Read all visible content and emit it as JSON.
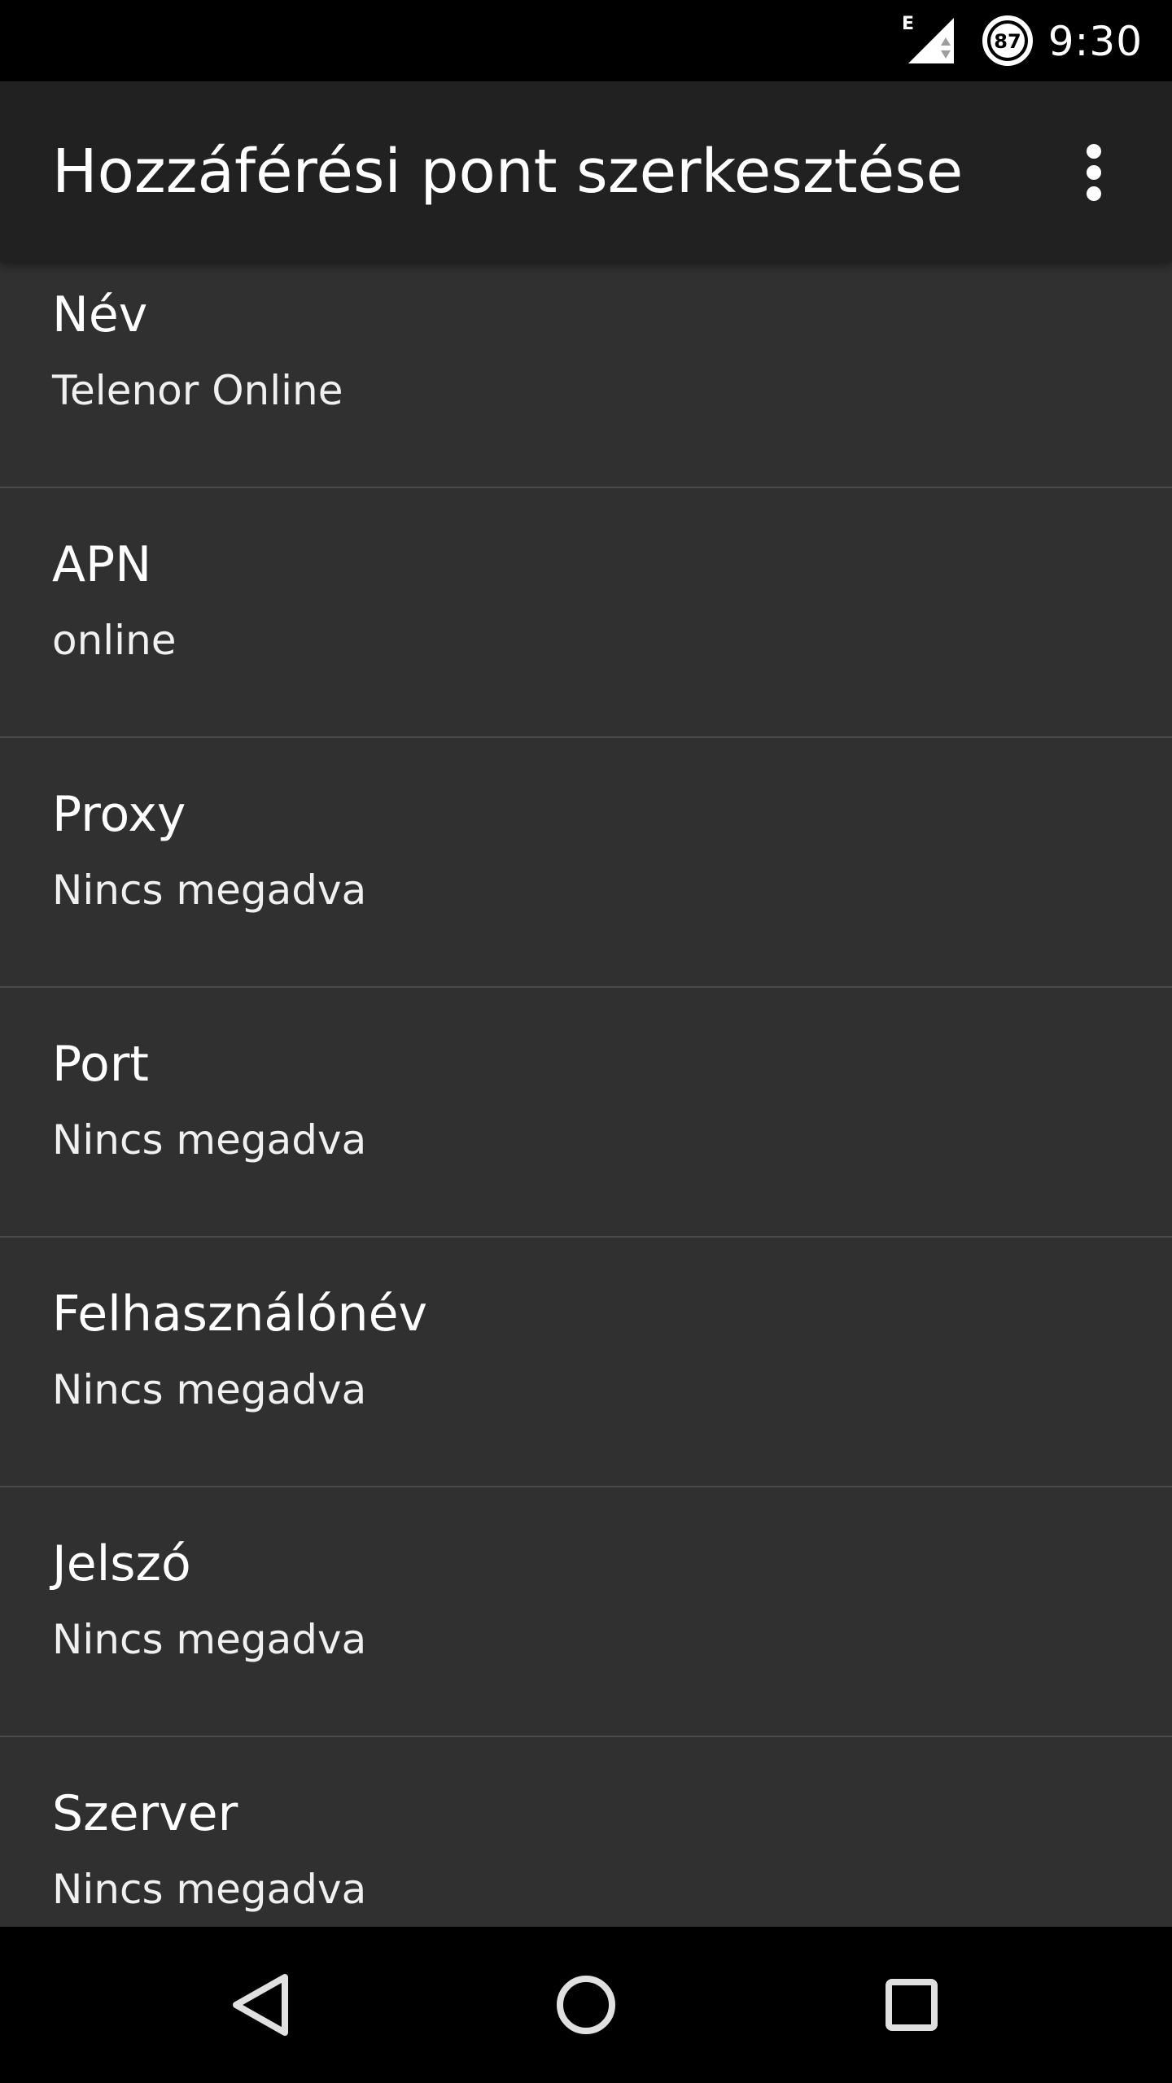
{
  "status_bar": {
    "time": "9:30",
    "network_type": "E",
    "battery_level": "87"
  },
  "app_bar": {
    "title": "Hozzáférési pont szerkesztése"
  },
  "preferences": [
    {
      "title": "Név",
      "summary": "Telenor Online"
    },
    {
      "title": "APN",
      "summary": "online"
    },
    {
      "title": "Proxy",
      "summary": "Nincs megadva"
    },
    {
      "title": "Port",
      "summary": "Nincs megadva"
    },
    {
      "title": "Felhasználónév",
      "summary": "Nincs megadva"
    },
    {
      "title": "Jelszó",
      "summary": "Nincs megadva"
    },
    {
      "title": "Szerver",
      "summary": "Nincs megadva"
    }
  ],
  "icons": {
    "signal": "signal-icon",
    "battery": "battery-icon",
    "overflow": "more-vert-icon",
    "back": "back-icon",
    "home": "home-icon",
    "recents": "recents-icon"
  },
  "colors": {
    "status_bar": "#000000",
    "app_bar": "#212121",
    "background": "#303030",
    "divider": "#4a4a4a",
    "text": "#ffffff"
  }
}
